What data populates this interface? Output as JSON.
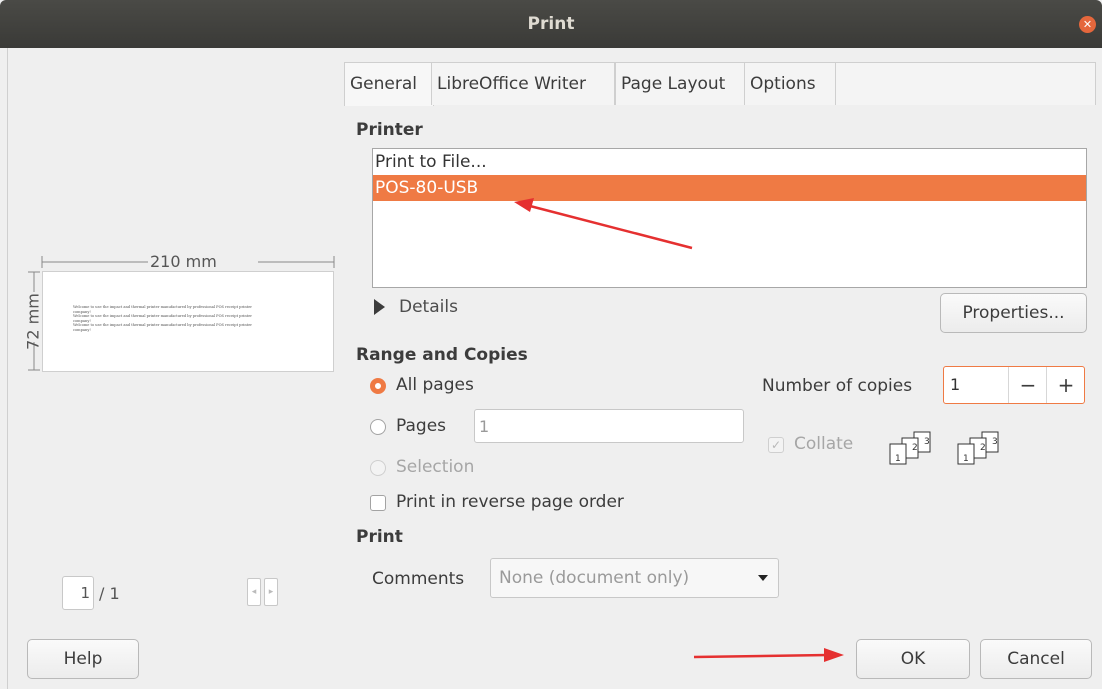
{
  "window": {
    "title": "Print"
  },
  "tabs": [
    "General",
    "LibreOffice Writer",
    "Page Layout",
    "Options"
  ],
  "printer": {
    "section_title": "Printer",
    "items": [
      "Print to File...",
      "POS-80-USB"
    ],
    "selected_index": 1,
    "details_label": "Details",
    "properties_label": "Properties..."
  },
  "range": {
    "section_title": "Range and Copies",
    "all_pages": "All pages",
    "pages": "Pages",
    "pages_value": "1",
    "selection": "Selection",
    "reverse": "Print in reverse page order",
    "copies_label": "Number of copies",
    "copies_value": "1",
    "minus": "−",
    "plus": "+",
    "collate": "Collate"
  },
  "print": {
    "section_title": "Print",
    "comments_label": "Comments",
    "comments_value": "None (document only)"
  },
  "preview": {
    "width_label": "210 mm",
    "height_label": "72 mm",
    "page_value": "1",
    "page_total": "/ 1",
    "lines": [
      "Welcome to use the impact and thermal printer manufactured by professional POS receipt printer",
      "company!",
      "Welcome to use the impact and thermal printer manufactured by professional POS receipt printer",
      "company!",
      "Welcome to use the impact and thermal printer manufactured by professional POS receipt printer",
      "company!"
    ]
  },
  "buttons": {
    "help": "Help",
    "ok": "OK",
    "cancel": "Cancel"
  },
  "colors": {
    "accent": "#ef7a44",
    "titlebar": "#3c3b37",
    "close": "#e5673c",
    "arrow": "#e53030"
  }
}
